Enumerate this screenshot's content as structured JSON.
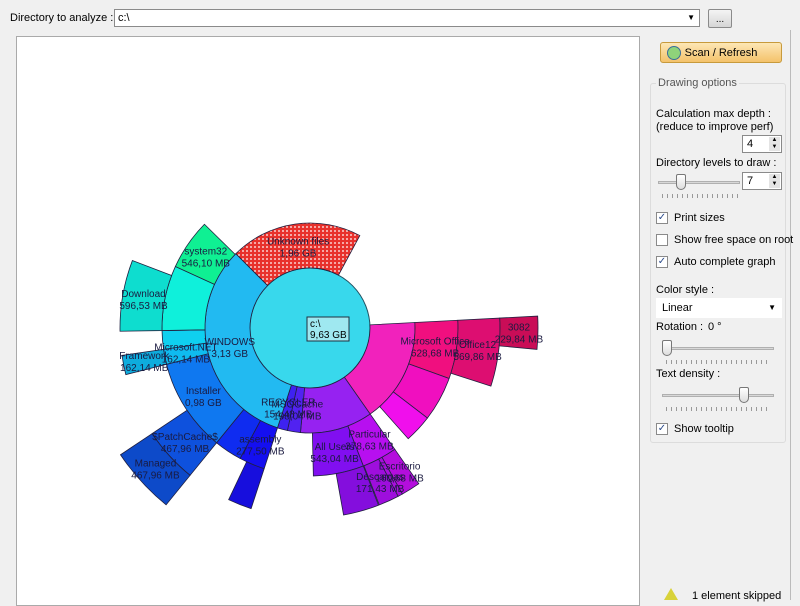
{
  "toolbar": {
    "dir_label": "Directory to analyze :",
    "dir_value": "c:\\",
    "browse_label": "..."
  },
  "panel": {
    "scan_label": "Scan / Refresh",
    "group_title": "Drawing options",
    "calc_depth_label": "Calculation max depth :",
    "calc_depth_hint": "(reduce to improve perf)",
    "calc_depth_value": "4",
    "levels_label": "Directory levels to draw :",
    "levels_value": "7",
    "levels_slider_fraction": 0.25,
    "print_sizes": {
      "label": "Print sizes",
      "checked": true
    },
    "show_free_space": {
      "label": "Show free space on root",
      "checked": false
    },
    "auto_complete": {
      "label": "Auto complete graph",
      "checked": true
    },
    "color_style_label": "Color style :",
    "color_style_value": "Linear",
    "rotation_label": "Rotation :",
    "rotation_value": "0 °",
    "rotation_slider_fraction": 0.0,
    "text_density_label": "Text density :",
    "text_density_slider_fraction": 0.75,
    "show_tooltip": {
      "label": "Show tooltip",
      "checked": true
    }
  },
  "status": {
    "text": "1 element skipped",
    "icon": "warning-icon"
  },
  "colors": {
    "unknown": "#e8312c",
    "root": "#38d8ec"
  },
  "tree": {
    "label": "c:\\",
    "size_text": "9,63 GB",
    "size_mb": 9861,
    "children": [
      {
        "label": "",
        "size_text": "",
        "size_mb": 1590,
        "children": [
          {
            "label": "Microsoft Office",
            "size_text": "628,68 MB",
            "size_mb": 628.68,
            "children": [
              {
                "label": "Office12",
                "size_text": "569,86 MB",
                "size_mb": 569.86,
                "children": [
                  {
                    "label": "3082",
                    "size_text": "229,84 MB",
                    "size_mb": 229.84
                  }
                ]
              }
            ]
          },
          {
            "label": "",
            "size_text": "",
            "size_mb": 480
          },
          {
            "label": "",
            "size_text": "",
            "size_mb": 300
          }
        ]
      },
      {
        "label": "",
        "size_text": "",
        "size_mb": 1100,
        "children": [
          {
            "label": "Particular",
            "size_text": "378,63 MB",
            "size_mb": 378.63,
            "children": [
              {
                "label": "Escritorio",
                "size_text": "160,68 MB",
                "size_mb": 160.68
              },
              {
                "label": "",
                "size_text": "",
                "size_mb": 40
              },
              {
                "label": "Descargas",
                "size_text": "171,43 MB",
                "size_mb": 171.43
              }
            ]
          },
          {
            "label": "All Users",
            "size_text": "543,04 MB",
            "size_mb": 543.04,
            "children": [
              {
                "label": "",
                "size_text": "",
                "size_mb": 300
              }
            ]
          }
        ]
      },
      {
        "label": "MSOCache",
        "size_text": "198,04 MB",
        "size_mb": 198
      },
      {
        "label": "RECYCLER",
        "size_text": "154,48 MB",
        "size_mb": 154
      },
      {
        "label": "WINDOWS",
        "size_text": "3,13 GB",
        "size_mb": 3205,
        "children": [
          {
            "label": "assembly",
            "size_text": "277,50 MB",
            "size_mb": 277.5,
            "children": [
              {
                "label": "",
                "size_text": "",
                "size_mb": 200
              }
            ]
          },
          {
            "label": "",
            "size_text": "",
            "size_mb": 300
          },
          {
            "label": "Installer",
            "size_text": "0,98 GB",
            "size_mb": 1004,
            "children": [
              {
                "label": "$PatchCache$",
                "size_text": "467,96 MB",
                "size_mb": 467.96,
                "children": [
                  {
                    "label": "Managed",
                    "size_text": "467,96 MB",
                    "size_mb": 467.96
                  }
                ]
              }
            ]
          },
          {
            "label": "Microsoft.NET",
            "size_text": "162,14 MB",
            "size_mb": 162.14,
            "children": [
              {
                "label": "Framework",
                "size_text": "162,14 MB",
                "size_mb": 162.14
              }
            ]
          },
          {
            "label": "",
            "size_text": "",
            "size_mb": 200
          },
          {
            "label": "",
            "size_text": "",
            "size_mb": 700,
            "children": [
              {
                "label": "Download",
                "size_text": "596,53 MB",
                "size_mb": 596.53
              }
            ]
          },
          {
            "label": "system32",
            "size_text": "546,10 MB",
            "size_mb": 546.1
          }
        ]
      },
      {
        "label": "Unknown files",
        "size_text": "1,96 GB",
        "size_mb": 2007,
        "unknown": true
      }
    ]
  }
}
